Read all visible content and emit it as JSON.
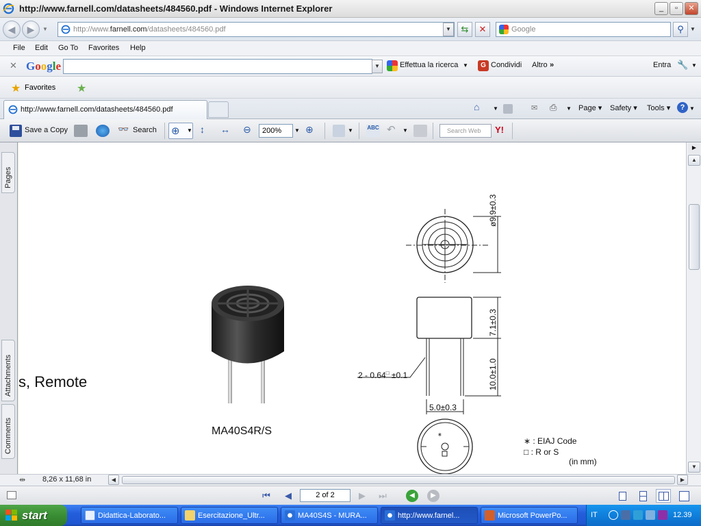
{
  "window": {
    "title": "http://www.farnell.com/datasheets/484560.pdf - Windows Internet Explorer",
    "buttons": [
      "_",
      "▫",
      "✕"
    ]
  },
  "address": {
    "url_prefix": "http://www.",
    "url_domain": "farnell.com",
    "url_path": "/datasheets/484560.pdf",
    "search_placeholder": "Google"
  },
  "menu": [
    "File",
    "Edit",
    "Go To",
    "Favorites",
    "Help"
  ],
  "google_toolbar": {
    "logo": "Google",
    "search_label": "Effettua la ricerca",
    "share_label": "Condividi",
    "more_label": "Altro",
    "signin_label": "Entra"
  },
  "favorites": {
    "label": "Favorites"
  },
  "tab": {
    "label": "http://www.farnell.com/datasheets/484560.pdf",
    "commands": [
      "Page",
      "Safety",
      "Tools"
    ]
  },
  "pdf_toolbar": {
    "save_label": "Save a Copy",
    "search_label": "Search",
    "zoom": "200%",
    "search_web_placeholder": "Search Web",
    "yahoo": "Y!"
  },
  "side_tabs": [
    "Pages",
    "Attachments",
    "Comments"
  ],
  "document": {
    "remote_text": "s, Remote",
    "product_name": "MA40S4R/S",
    "dim_diameter": "ø9.9±0.3",
    "dim_height": "7.1±0.3",
    "dim_lead_len": "10.0±1.0",
    "dim_pin": "2 - 0.64",
    "dim_pin_tol": "±0.1",
    "dim_spacing": "5.0±0.3",
    "legend_eiaj": "∗ : EIAJ Code",
    "legend_r": "□ : R or S",
    "units": "(in mm)"
  },
  "status": {
    "page_size": "8,26 x 11,68 in",
    "page_indicator": "2 of 2"
  },
  "taskbar": {
    "start_label": "start",
    "tasks": [
      "Didattica-Laborato...",
      "Esercitazione_Ultr...",
      "MA40S4S - MURA...",
      "http://www.farnel...",
      "Microsoft PowerPo..."
    ],
    "language": "IT",
    "clock": "12.39"
  }
}
